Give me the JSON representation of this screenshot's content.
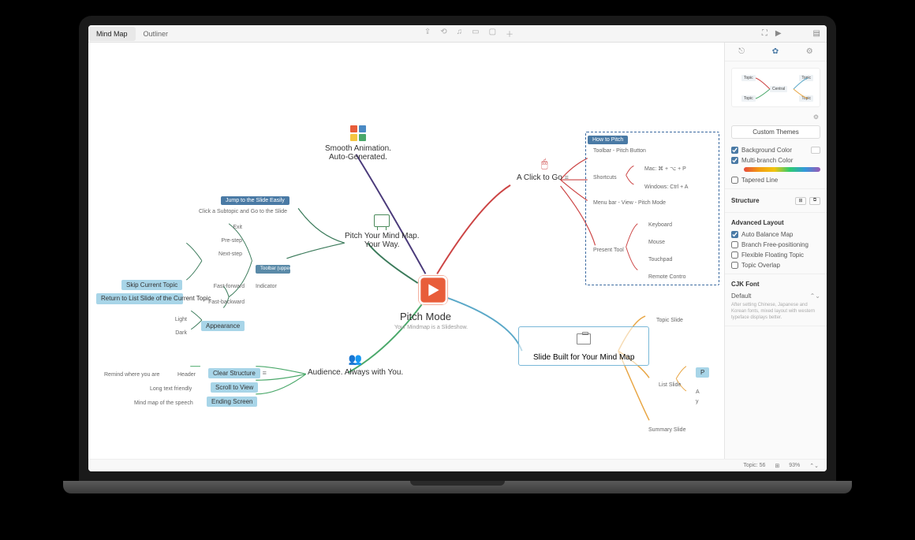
{
  "topbar": {
    "tabs": {
      "mindmap": "Mind Map",
      "outliner": "Outliner"
    },
    "icons": [
      "share",
      "undo",
      "audio",
      "note",
      "screen",
      "add"
    ],
    "right_icons": [
      "fullscreen",
      "play",
      "panel"
    ]
  },
  "central": {
    "title": "Pitch Mode",
    "subtitle": "Your Mindmap is a Slideshow."
  },
  "branches": {
    "smooth": {
      "line1": "Smooth Animation.",
      "line2": "Auto-Generated."
    },
    "click": {
      "label": "A Click to Go"
    },
    "pitch_your": {
      "line1": "Pitch Your Mind Map.",
      "line2": "Your Way."
    },
    "slide_built": {
      "label": "Slide Built for Your Mind Map"
    },
    "audience": {
      "label": "Audience. Always with You."
    }
  },
  "how_to_pitch": {
    "badge": "How to Pitch",
    "items": {
      "toolbar": "Toolbar - Pitch Button",
      "shortcuts": "Shortcuts",
      "mac": "Mac: ⌘ + ⌥ + P",
      "windows": "Windows: Ctrl + A",
      "menubar": "Menu bar - View - Pitch Mode",
      "present_tool": "Present Tool",
      "keyboard": "Keyboard",
      "mouse": "Mouse",
      "touchpad": "Touchpad",
      "remote": "Remote Contro"
    }
  },
  "jump": {
    "badge": "Jump to the Slide Easily",
    "click_subtopic": "Click a Subtopic and Go to the Slide",
    "exit": "Exit",
    "prestep": "Pre-step",
    "nextstep": "Next-step",
    "fastfwd": "Fast-forward",
    "fastbwd": "Fast-backward",
    "light": "Light",
    "dark": "Dark",
    "toolbar_upper": "Toolbar (upper right)",
    "indicator": "Indicator",
    "skip": "Skip Current Topic",
    "return_list": "Return to List Slide of the Current Topic",
    "appearance": "Appearance"
  },
  "audience_sub": {
    "remind": "Remind where you are",
    "header": "Header",
    "clear": "Clear Structure",
    "longtext": "Long text friendly",
    "scroll": "Scroll to View",
    "mindmap_speech": "Mind map of the speech",
    "ending": "Ending Screen"
  },
  "slides": {
    "topic": "Topic Slide",
    "list": "List Slide",
    "summary": "Summary Slide",
    "p": "P",
    "a": "A",
    "y": "y"
  },
  "panel": {
    "custom_themes": "Custom Themes",
    "bg_color": "Background Color",
    "multi_branch": "Multi-branch Color",
    "tapered": "Tapered Line",
    "structure": "Structure",
    "advanced": "Advanced Layout",
    "auto_balance": "Auto Balance Map",
    "branch_free": "Branch Free-positioning",
    "flexible": "Flexible Floating Topic",
    "overlap": "Topic Overlap",
    "cjk": "CJK Font",
    "default": "Default",
    "hint": "After setting Chinese, Japanese and Korean fonts, mixed layout with western typeface displays better.",
    "preview_central": "Central",
    "preview_topic": "Topic"
  },
  "status": {
    "topics": "Topic: 56",
    "zoom": "93%"
  }
}
